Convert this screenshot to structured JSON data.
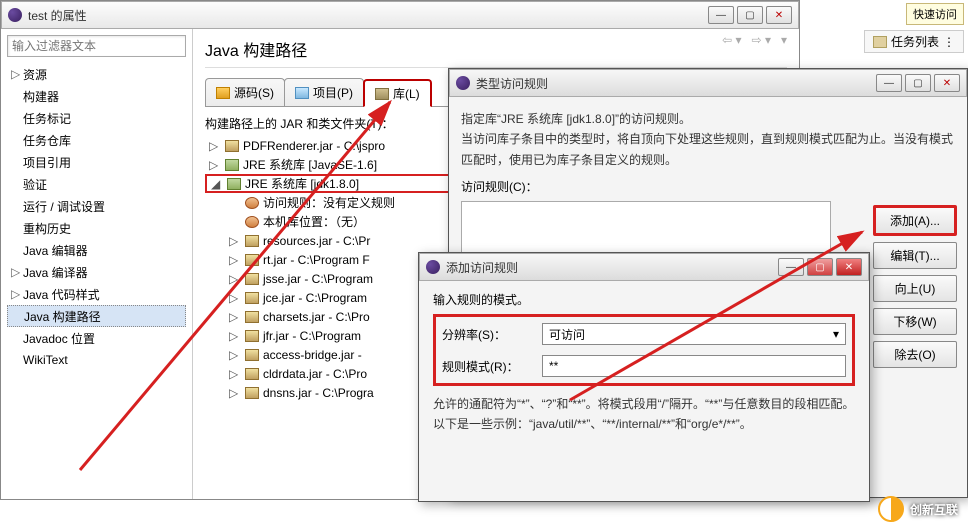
{
  "quick_access": "快速访问",
  "tasklist": "任务列表",
  "main": {
    "title": "test 的属性",
    "filter_placeholder": "输入过滤器文本",
    "heading": "Java 构建路径",
    "tree": [
      {
        "label": "资源",
        "caret": "▷"
      },
      {
        "label": "构建器"
      },
      {
        "label": "任务标记"
      },
      {
        "label": "任务仓库"
      },
      {
        "label": "项目引用"
      },
      {
        "label": "验证"
      },
      {
        "label": "运行 / 调试设置"
      },
      {
        "label": "重构历史"
      },
      {
        "label": "Java 编辑器"
      },
      {
        "label": "Java 编译器",
        "caret": "▷"
      },
      {
        "label": "Java 代码样式",
        "caret": "▷"
      },
      {
        "label": "Java 构建路径",
        "selected": true
      },
      {
        "label": "Javadoc 位置"
      },
      {
        "label": "WikiText"
      }
    ],
    "tabs": {
      "source": "源码(S)",
      "project": "项目(P)",
      "library": "库(L)"
    },
    "jar_header": "构建路径上的 JAR 和类文件夹(T)：",
    "jars": [
      {
        "caret": "▷",
        "label": "PDFRenderer.jar - C:\\jspro"
      },
      {
        "caret": "▷",
        "label": "JRE 系统库 [JavaSE-1.6]",
        "sys": true
      },
      {
        "caret": "◢",
        "label": "JRE 系统库 [jdk1.8.0]",
        "sys": true,
        "hl": true
      },
      {
        "indent": 1,
        "rule": true,
        "label": "访问规则：没有定义规则"
      },
      {
        "indent": 1,
        "rule": true,
        "label": "本机库位置：（无）"
      },
      {
        "caret": "▷",
        "indent": 1,
        "label": "resources.jar - C:\\Pr"
      },
      {
        "caret": "▷",
        "indent": 1,
        "label": "rt.jar - C:\\Program F"
      },
      {
        "caret": "▷",
        "indent": 1,
        "label": "jsse.jar - C:\\Program"
      },
      {
        "caret": "▷",
        "indent": 1,
        "label": "jce.jar - C:\\Program"
      },
      {
        "caret": "▷",
        "indent": 1,
        "label": "charsets.jar - C:\\Pro"
      },
      {
        "caret": "▷",
        "indent": 1,
        "label": "jfr.jar - C:\\Program"
      },
      {
        "caret": "▷",
        "indent": 1,
        "label": "access-bridge.jar -"
      },
      {
        "caret": "▷",
        "indent": 1,
        "label": "cldrdata.jar - C:\\Pro"
      },
      {
        "caret": "▷",
        "indent": 1,
        "label": "dnsns.jar - C:\\Progra"
      }
    ]
  },
  "dlg2": {
    "title": "类型访问规则",
    "desc1": "指定库“JRE 系统库 [jdk1.8.0]”的访问规则。",
    "desc2": "当访问库子条目中的类型时，将自顶向下处理这些规则，直到规则模式匹配为止。当没有模式匹配时，使用已为库子条目定义的规则。",
    "rules_label": "访问规则(C)：",
    "buttons": {
      "add": "添加(A)...",
      "edit": "编辑(T)...",
      "up": "向上(U)",
      "down": "下移(W)",
      "remove": "除去(O)"
    }
  },
  "dlg3": {
    "title": "添加访问规则",
    "intro": "输入规则的模式。",
    "resolution_label": "分辨率(S)：",
    "resolution_value": "可访问",
    "pattern_label": "规则模式(R)：",
    "pattern_value": "**",
    "help1": "允许的通配符为“*”、“?”和“**”。将模式段用“/”隔开。“**”与任意数目的段相匹配。",
    "help2": "以下是一些示例：“java/util/**”、“**/internal/**”和“org/e*/**”。"
  },
  "watermark": "创新互联"
}
